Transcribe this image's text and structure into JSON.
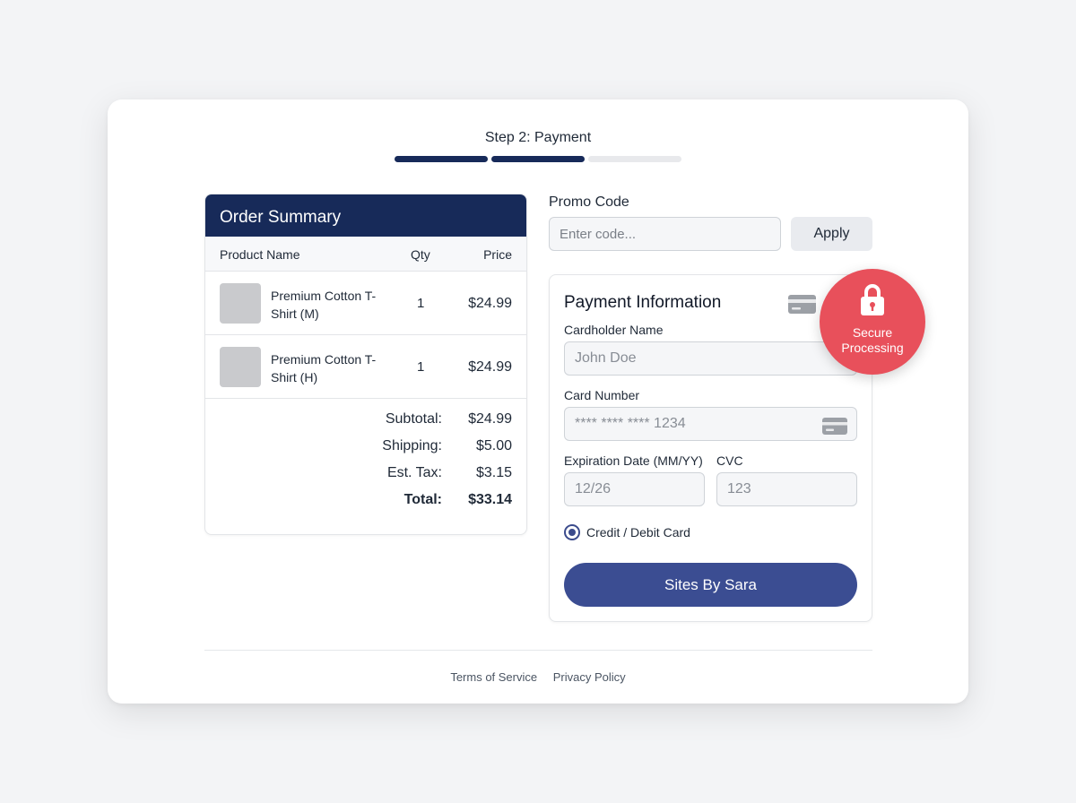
{
  "colors": {
    "navy": "#172a59",
    "progress_active": "#172a59",
    "progress_inactive": "#e8e9ec",
    "button_blue": "#3b4d92",
    "badge_red": "#e8505b"
  },
  "progress": {
    "title": "Step 2: Payment",
    "segments": [
      {
        "state": "complete"
      },
      {
        "state": "complete"
      },
      {
        "state": "incomplete"
      }
    ]
  },
  "order_summary": {
    "title": "Order Summary",
    "columns": {
      "name": "Product Name",
      "qty": "Qty",
      "price": "Price"
    },
    "items": [
      {
        "name": "Premium Cotton T-Shirt (M)",
        "qty": "1",
        "price": "$24.99"
      },
      {
        "name": "Premium Cotton T-Shirt (H)",
        "qty": "1",
        "price": "$24.99"
      }
    ],
    "totals": [
      {
        "label": "Subtotal:",
        "value": "$24.99"
      },
      {
        "label": "Shipping:",
        "value": "$5.00"
      },
      {
        "label": "Est. Tax:",
        "value": "$3.15"
      },
      {
        "label": "Total:",
        "value": "$33.14"
      }
    ]
  },
  "promo": {
    "label": "Promo Code",
    "placeholder": "Enter code...",
    "apply_label": "Apply"
  },
  "payment": {
    "title": "Payment Information",
    "cardholder": {
      "label": "Cardholder Name",
      "placeholder": "John Doe"
    },
    "card_number": {
      "label": "Card Number",
      "placeholder": "**** **** **** 1234"
    },
    "expiry": {
      "label": "Expiration Date (MM/YY)",
      "placeholder": "12/26"
    },
    "cvc": {
      "label": "CVC",
      "placeholder": "123"
    },
    "method": {
      "label": "Credit / Debit Card"
    },
    "submit_label": "Sites By Sara"
  },
  "badge": {
    "line1": "Secure",
    "line2": "Processing",
    "icon": "lock-icon"
  },
  "footer": {
    "terms": "Terms of Service",
    "privacy": "Privacy Policy"
  }
}
